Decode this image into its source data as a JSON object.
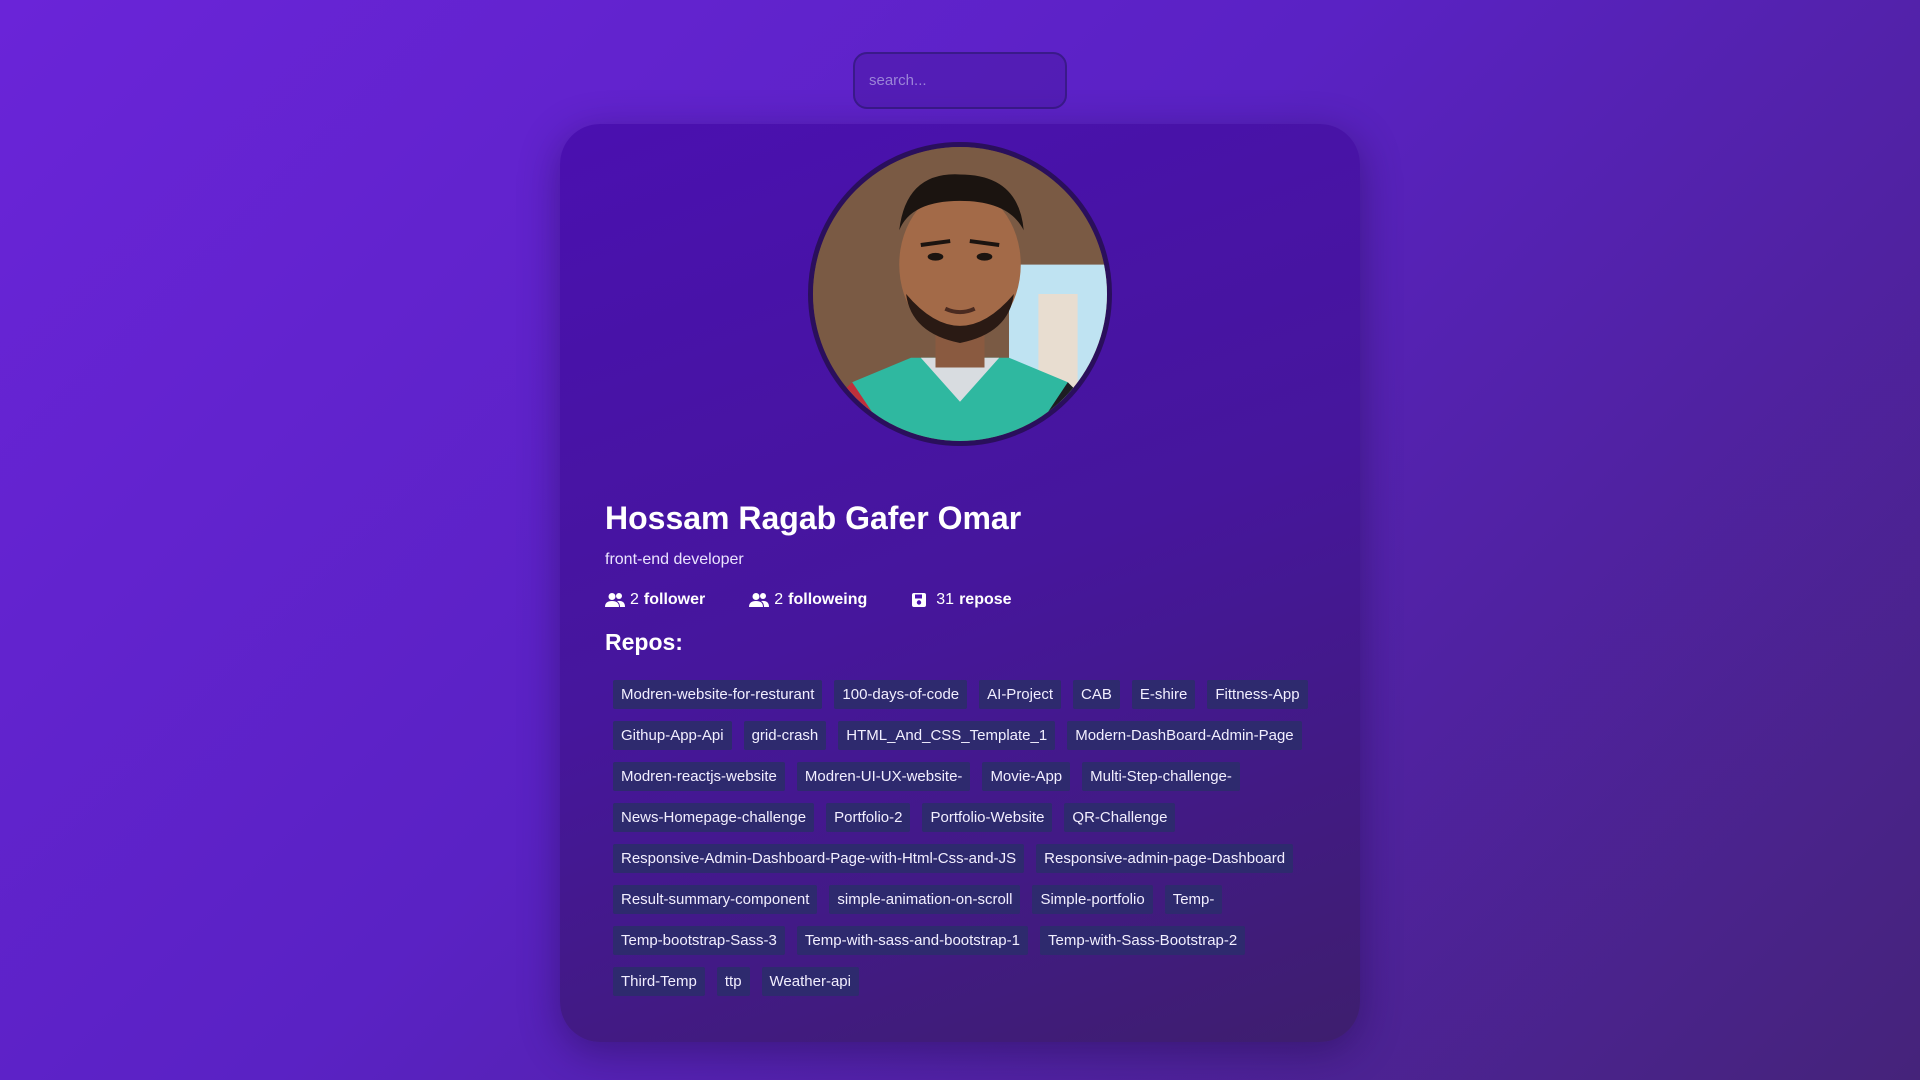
{
  "search": {
    "placeholder": "search..."
  },
  "profile": {
    "name": "Hossam Ragab Gafer Omar",
    "bio": "front-end developer",
    "followers": {
      "count": "2",
      "label": "follower"
    },
    "following": {
      "count": "2",
      "label": "followeing"
    },
    "repos": {
      "count": "31",
      "label": "repose"
    }
  },
  "repos_heading": "Repos:",
  "repos": [
    "Modren-website-for-resturant",
    "100-days-of-code",
    "AI-Project",
    "CAB",
    "E-shire",
    "Fittness-App",
    "Githup-App-Api",
    "grid-crash",
    "HTML_And_CSS_Template_1",
    "Modern-DashBoard-Admin-Page",
    "Modren-reactjs-website",
    "Modren-UI-UX-website-",
    "Movie-App",
    "Multi-Step-challenge-",
    "News-Homepage-challenge",
    "Portfolio-2",
    "Portfolio-Website",
    "QR-Challenge",
    "Responsive-Admin-Dashboard-Page-with-Html-Css-and-JS",
    "Responsive-admin-page-Dashboard",
    "Result-summary-component",
    "simple-animation-on-scroll",
    "Simple-portfolio",
    "Temp-",
    "Temp-bootstrap-Sass-3",
    "Temp-with-sass-and-bootstrap-1",
    "Temp-with-Sass-Bootstrap-2",
    "Third-Temp",
    "ttp",
    "Weather-api"
  ],
  "icons": {
    "followers": "users-icon",
    "following": "users-icon",
    "repos": "save-icon"
  },
  "colors": {
    "background": "#6a24d8",
    "card": "#4a10b0",
    "repo_tag": "#2e2a6e",
    "text": "#ffffff"
  }
}
